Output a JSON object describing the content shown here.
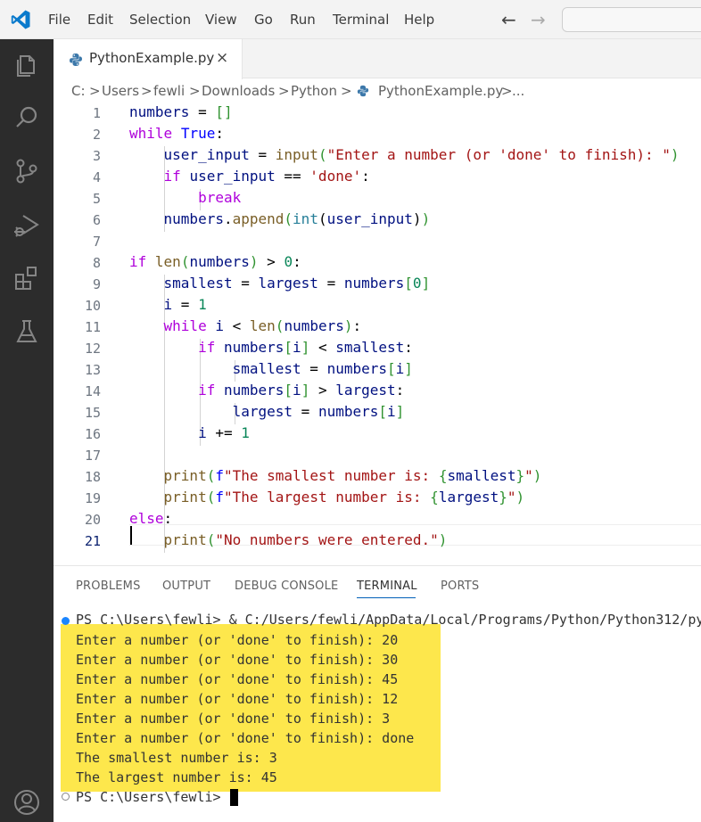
{
  "menu": {
    "items": [
      "File",
      "Edit",
      "Selection",
      "View",
      "Go",
      "Run",
      "Terminal",
      "Help"
    ],
    "back_arrow": "←",
    "forward_arrow": "→"
  },
  "activity_bar": {
    "icons": [
      "explorer-icon",
      "search-icon",
      "source-control-icon",
      "run-debug-icon",
      "extensions-icon",
      "testing-icon",
      "account-icon"
    ]
  },
  "tab": {
    "name": "PythonExample.py",
    "close": "×"
  },
  "breadcrumb": {
    "items": [
      "C:",
      "Users",
      "fewli",
      "Downloads",
      "Python",
      "PythonExample.py",
      "..."
    ],
    "separator": ">"
  },
  "editor": {
    "line_numbers": [
      "1",
      "2",
      "3",
      "4",
      "5",
      "6",
      "7",
      "8",
      "9",
      "10",
      "11",
      "12",
      "13",
      "14",
      "15",
      "16",
      "17",
      "18",
      "19",
      "20",
      "21"
    ],
    "active_line": 21
  },
  "panel": {
    "tabs": [
      "PROBLEMS",
      "OUTPUT",
      "DEBUG CONSOLE",
      "TERMINAL",
      "PORTS"
    ],
    "active_tab": "TERMINAL"
  },
  "terminal": {
    "command_line": "PS C:\\Users\\fewli> & C:/Users/fewli/AppData/Local/Programs/Python/Python312/py",
    "output": [
      "Enter a number (or 'done' to finish): 20",
      "Enter a number (or 'done' to finish): 30",
      "Enter a number (or 'done' to finish): 45",
      "Enter a number (or 'done' to finish): 12",
      "Enter a number (or 'done' to finish): 3",
      "Enter a number (or 'done' to finish): done",
      "The smallest number is: 3",
      "The largest number is: 45"
    ],
    "prompt": "PS C:\\Users\\fewli>"
  },
  "colors": {
    "activity_bar": "#2c2c2c",
    "highlight": "#fde74c",
    "success_dot": "#1a85ff",
    "keyword": "#af00db"
  }
}
